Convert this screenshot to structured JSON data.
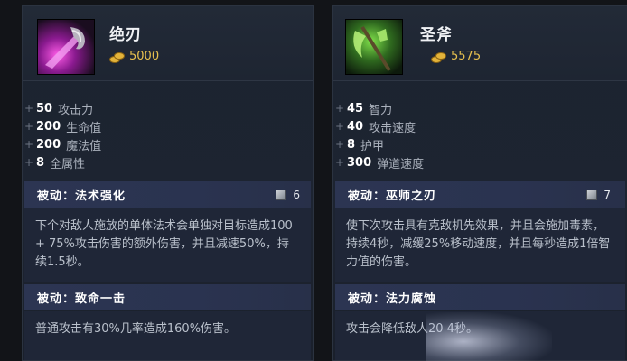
{
  "items": [
    {
      "name": "绝刃",
      "cost": "5000",
      "image_icon": "purple-blade-icon",
      "stats": [
        {
          "value": "50",
          "label": "攻击力"
        },
        {
          "value": "200",
          "label": "生命值"
        },
        {
          "value": "200",
          "label": "魔法值"
        },
        {
          "value": "8",
          "label": "全属性"
        }
      ],
      "abilities": [
        {
          "title": "被动：法术强化",
          "cooldown": "6",
          "description": "下个对敌人施放的单体法术会单独对目标造成100 + 75%攻击伤害的额外伤害，并且减速50%，持续1.5秒。"
        },
        {
          "title": "被动：致命一击",
          "cooldown": "",
          "description": "普通攻击有30%几率造成160%伤害。"
        }
      ]
    },
    {
      "name": "圣斧",
      "cost": "5575",
      "image_icon": "green-axe-icon",
      "stats": [
        {
          "value": "45",
          "label": "智力"
        },
        {
          "value": "40",
          "label": "攻击速度"
        },
        {
          "value": "8",
          "label": "护甲"
        },
        {
          "value": "300",
          "label": "弹道速度"
        }
      ],
      "abilities": [
        {
          "title": "被动：巫师之刃",
          "cooldown": "7",
          "description": "使下次攻击具有克敌机先效果，并且会施加毒素，持续4秒，减缓25%移动速度，并且每秒造成1倍智力值的伤害。"
        },
        {
          "title": "被动：法力腐蚀",
          "cooldown": "",
          "description": "攻击会降低敌人20 4秒。"
        }
      ]
    }
  ],
  "colors": {
    "gold": "#e7c04f",
    "ability_header": "#2c3552",
    "panel": "#1c2330"
  }
}
